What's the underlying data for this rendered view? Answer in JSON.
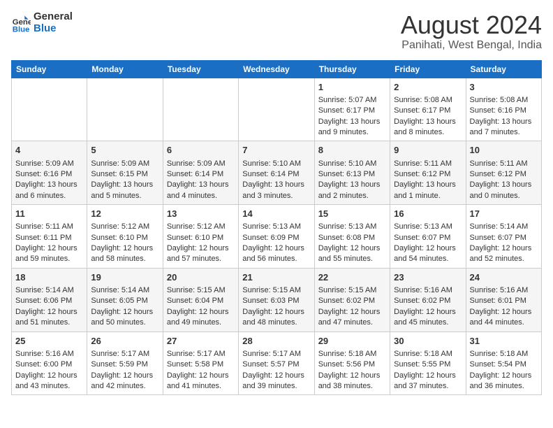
{
  "header": {
    "logo_line1": "General",
    "logo_line2": "Blue",
    "title": "August 2024",
    "subtitle": "Panihati, West Bengal, India"
  },
  "days_of_week": [
    "Sunday",
    "Monday",
    "Tuesday",
    "Wednesday",
    "Thursday",
    "Friday",
    "Saturday"
  ],
  "weeks": [
    [
      {
        "day": "",
        "content": ""
      },
      {
        "day": "",
        "content": ""
      },
      {
        "day": "",
        "content": ""
      },
      {
        "day": "",
        "content": ""
      },
      {
        "day": "1",
        "content": "Sunrise: 5:07 AM\nSunset: 6:17 PM\nDaylight: 13 hours\nand 9 minutes."
      },
      {
        "day": "2",
        "content": "Sunrise: 5:08 AM\nSunset: 6:17 PM\nDaylight: 13 hours\nand 8 minutes."
      },
      {
        "day": "3",
        "content": "Sunrise: 5:08 AM\nSunset: 6:16 PM\nDaylight: 13 hours\nand 7 minutes."
      }
    ],
    [
      {
        "day": "4",
        "content": "Sunrise: 5:09 AM\nSunset: 6:16 PM\nDaylight: 13 hours\nand 6 minutes."
      },
      {
        "day": "5",
        "content": "Sunrise: 5:09 AM\nSunset: 6:15 PM\nDaylight: 13 hours\nand 5 minutes."
      },
      {
        "day": "6",
        "content": "Sunrise: 5:09 AM\nSunset: 6:14 PM\nDaylight: 13 hours\nand 4 minutes."
      },
      {
        "day": "7",
        "content": "Sunrise: 5:10 AM\nSunset: 6:14 PM\nDaylight: 13 hours\nand 3 minutes."
      },
      {
        "day": "8",
        "content": "Sunrise: 5:10 AM\nSunset: 6:13 PM\nDaylight: 13 hours\nand 2 minutes."
      },
      {
        "day": "9",
        "content": "Sunrise: 5:11 AM\nSunset: 6:12 PM\nDaylight: 13 hours\nand 1 minute."
      },
      {
        "day": "10",
        "content": "Sunrise: 5:11 AM\nSunset: 6:12 PM\nDaylight: 13 hours\nand 0 minutes."
      }
    ],
    [
      {
        "day": "11",
        "content": "Sunrise: 5:11 AM\nSunset: 6:11 PM\nDaylight: 12 hours\nand 59 minutes."
      },
      {
        "day": "12",
        "content": "Sunrise: 5:12 AM\nSunset: 6:10 PM\nDaylight: 12 hours\nand 58 minutes."
      },
      {
        "day": "13",
        "content": "Sunrise: 5:12 AM\nSunset: 6:10 PM\nDaylight: 12 hours\nand 57 minutes."
      },
      {
        "day": "14",
        "content": "Sunrise: 5:13 AM\nSunset: 6:09 PM\nDaylight: 12 hours\nand 56 minutes."
      },
      {
        "day": "15",
        "content": "Sunrise: 5:13 AM\nSunset: 6:08 PM\nDaylight: 12 hours\nand 55 minutes."
      },
      {
        "day": "16",
        "content": "Sunrise: 5:13 AM\nSunset: 6:07 PM\nDaylight: 12 hours\nand 54 minutes."
      },
      {
        "day": "17",
        "content": "Sunrise: 5:14 AM\nSunset: 6:07 PM\nDaylight: 12 hours\nand 52 minutes."
      }
    ],
    [
      {
        "day": "18",
        "content": "Sunrise: 5:14 AM\nSunset: 6:06 PM\nDaylight: 12 hours\nand 51 minutes."
      },
      {
        "day": "19",
        "content": "Sunrise: 5:14 AM\nSunset: 6:05 PM\nDaylight: 12 hours\nand 50 minutes."
      },
      {
        "day": "20",
        "content": "Sunrise: 5:15 AM\nSunset: 6:04 PM\nDaylight: 12 hours\nand 49 minutes."
      },
      {
        "day": "21",
        "content": "Sunrise: 5:15 AM\nSunset: 6:03 PM\nDaylight: 12 hours\nand 48 minutes."
      },
      {
        "day": "22",
        "content": "Sunrise: 5:15 AM\nSunset: 6:02 PM\nDaylight: 12 hours\nand 47 minutes."
      },
      {
        "day": "23",
        "content": "Sunrise: 5:16 AM\nSunset: 6:02 PM\nDaylight: 12 hours\nand 45 minutes."
      },
      {
        "day": "24",
        "content": "Sunrise: 5:16 AM\nSunset: 6:01 PM\nDaylight: 12 hours\nand 44 minutes."
      }
    ],
    [
      {
        "day": "25",
        "content": "Sunrise: 5:16 AM\nSunset: 6:00 PM\nDaylight: 12 hours\nand 43 minutes."
      },
      {
        "day": "26",
        "content": "Sunrise: 5:17 AM\nSunset: 5:59 PM\nDaylight: 12 hours\nand 42 minutes."
      },
      {
        "day": "27",
        "content": "Sunrise: 5:17 AM\nSunset: 5:58 PM\nDaylight: 12 hours\nand 41 minutes."
      },
      {
        "day": "28",
        "content": "Sunrise: 5:17 AM\nSunset: 5:57 PM\nDaylight: 12 hours\nand 39 minutes."
      },
      {
        "day": "29",
        "content": "Sunrise: 5:18 AM\nSunset: 5:56 PM\nDaylight: 12 hours\nand 38 minutes."
      },
      {
        "day": "30",
        "content": "Sunrise: 5:18 AM\nSunset: 5:55 PM\nDaylight: 12 hours\nand 37 minutes."
      },
      {
        "day": "31",
        "content": "Sunrise: 5:18 AM\nSunset: 5:54 PM\nDaylight: 12 hours\nand 36 minutes."
      }
    ]
  ]
}
